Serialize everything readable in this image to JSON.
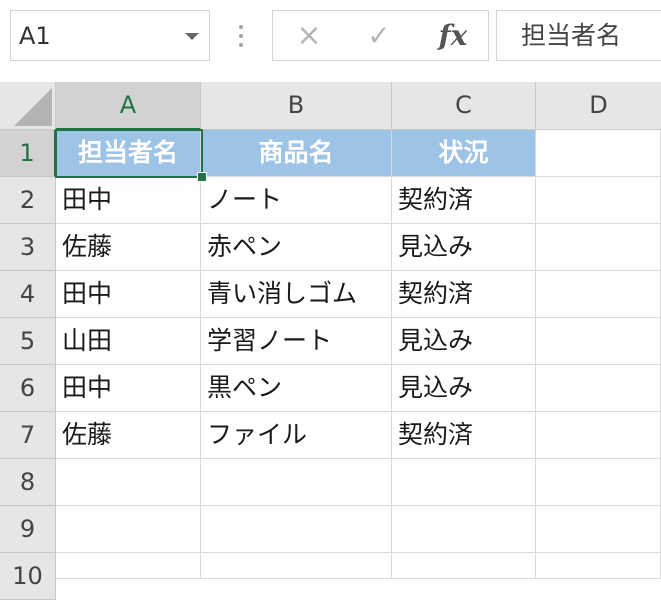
{
  "formula_bar": {
    "name_box": "A1",
    "cancel_icon": "×",
    "enter_icon": "✓",
    "fx_label": "fx",
    "formula_text": "担当者名"
  },
  "columns": [
    "A",
    "B",
    "C",
    "D"
  ],
  "rows": [
    "1",
    "2",
    "3",
    "4",
    "5",
    "6",
    "7",
    "8",
    "9",
    "10"
  ],
  "table": {
    "headers": [
      "担当者名",
      "商品名",
      "状況"
    ],
    "records": [
      [
        "田中",
        "ノート",
        "契約済"
      ],
      [
        "佐藤",
        "赤ペン",
        "見込み"
      ],
      [
        "田中",
        "青い消しゴム",
        "契約済"
      ],
      [
        "山田",
        "学習ノート",
        "見込み"
      ],
      [
        "田中",
        "黒ペン",
        "見込み"
      ],
      [
        "佐藤",
        "ファイル",
        "契約済"
      ]
    ]
  },
  "colors": {
    "header_fill": "#9dc3e6",
    "selection": "#217346"
  }
}
